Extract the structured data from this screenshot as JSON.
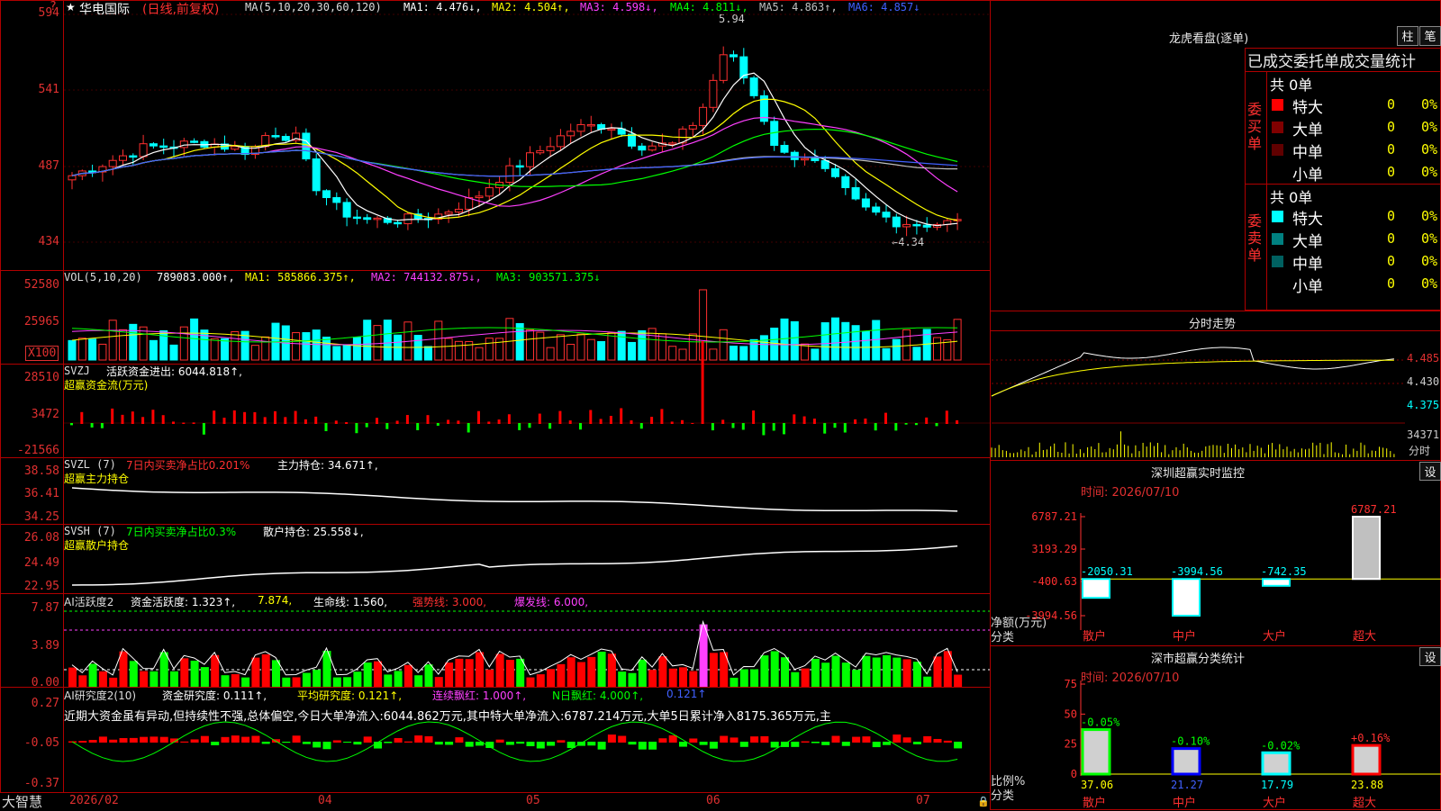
{
  "header": {
    "title": "华电国际",
    "mode": "(日线,前复权)",
    "ma_label": "MA(5,10,20,30,60,120)",
    "ma1": "MA1: 4.476↓,",
    "ma2": "MA2: 4.504↑,",
    "ma3": "MA3: 4.598↓,",
    "ma4": "MA4: 4.811↓,",
    "ma5": "MA5: 4.863↑,",
    "ma6": "MA6: 4.857↓",
    "high_mark": "5.94",
    "low_mark": "←4.34"
  },
  "price_axis": [
    "594",
    "541",
    "487",
    "434"
  ],
  "vol_panel": {
    "label": "VOL(5,10,20)",
    "value": "789083.000↑,",
    "ma1": "MA1: 585866.375↑,",
    "ma2": "MA2: 744132.875↓,",
    "ma3": "MA3: 903571.375↓",
    "axis": [
      "52580",
      "25965"
    ],
    "unit": "X100"
  },
  "svzj_panel": {
    "label": "SVZJ",
    "value": "活跃资金进出: 6044.818↑,",
    "sub": "超赢资金流(万元)",
    "axis": [
      "28510",
      "3472",
      "-21566"
    ]
  },
  "svzl_panel": {
    "label": "SVZL (7)",
    "value1": "7日内买卖净占比0.201%",
    "value2": "主力持仓: 34.671↑,",
    "sub": "超赢主力持仓",
    "axis": [
      "38.58",
      "36.41",
      "34.25"
    ]
  },
  "svsh_panel": {
    "label": "SVSH (7)",
    "value1": "7日内买卖净占比0.3%",
    "value2": "散户持仓: 25.558↓,",
    "sub": "超赢散户持仓",
    "axis": [
      "26.08",
      "24.49",
      "22.95"
    ]
  },
  "ai1_panel": {
    "label": "AI活跃度2",
    "v1": "资金活跃度: 1.323↑,",
    "v2": "7.874,",
    "v3": "生命线: 1.560,",
    "v4": "强势线: 3.000,",
    "v5": "爆发线: 6.000,",
    "axis": [
      "7.87",
      "3.89",
      "0.00"
    ]
  },
  "ai2_panel": {
    "label": "AI研究度2(10)",
    "v1": "资金研究度: 0.111↑,",
    "v2": "平均研究度: 0.121↑,",
    "v3": "连续飘红: 1.000↑,",
    "v4": "N日飘红: 4.000↑,",
    "v5": "0.121↑",
    "note": "近期大资金虽有异动,但持续性不强,总体偏空,今日大单净流入:6044.862万元,其中特大单净流入:6787.214万元,大单5日累计净入8175.365万元,主",
    "axis": [
      "0.27",
      "-0.05",
      "-0.37"
    ]
  },
  "date_axis": [
    "2026/02",
    "04",
    "05",
    "06",
    "07"
  ],
  "brand": "大智慧",
  "longhu": {
    "title": "龙虎看盘(逐单)",
    "btn1": "柱",
    "btn2": "笔",
    "subtitle": "已成交委托单成交量统计",
    "buy_label": "委买单",
    "sell_label": "委卖单",
    "buy_total": "共 0单",
    "sell_total": "共 0单",
    "buy_rows": [
      {
        "name": "特大",
        "count": "0",
        "pct": "0%",
        "color": "#ff0000"
      },
      {
        "name": "大单",
        "count": "0",
        "pct": "0%",
        "color": "#800000"
      },
      {
        "name": "中单",
        "count": "0",
        "pct": "0%",
        "color": "#600000"
      },
      {
        "name": "小单",
        "count": "0",
        "pct": "0%",
        "color": "#000000"
      }
    ],
    "sell_rows": [
      {
        "name": "特大",
        "count": "0",
        "pct": "0%",
        "color": "#00ffff"
      },
      {
        "name": "大单",
        "count": "0",
        "pct": "0%",
        "color": "#008080"
      },
      {
        "name": "中单",
        "count": "0",
        "pct": "0%",
        "color": "#006060"
      },
      {
        "name": "小单",
        "count": "0",
        "pct": "0%",
        "color": "#000000"
      }
    ]
  },
  "intraday": {
    "title": "分时走势",
    "p1": "4.485",
    "p2": "4.430",
    "p3": "4.375",
    "vol": "34371",
    "vol_label": "分时"
  },
  "monitor": {
    "title": "深圳超赢实时监控",
    "btn": "设",
    "time": "时间: 2026/07/10",
    "axis": [
      "6787.21",
      "3193.29",
      "-400.63",
      "-3994.56"
    ],
    "ylabel1": "净额(万元)",
    "ylabel2": "分类",
    "categories": [
      "散户",
      "中户",
      "大户",
      "超大"
    ],
    "values": [
      "-2050.31",
      "-3994.56",
      "-742.35",
      "6787.21"
    ]
  },
  "classify": {
    "title": "深市超赢分类统计",
    "btn": "设",
    "time": "时间: 2026/07/10",
    "axis": [
      "75",
      "50",
      "25",
      "0"
    ],
    "ylabel1": "比例%",
    "ylabel2": "分类",
    "categories": [
      "散户",
      "中户",
      "大户",
      "超大"
    ],
    "values": [
      "37.06",
      "21.27",
      "17.79",
      "23.88"
    ],
    "changes": [
      "-0.05%",
      "-0.10%",
      "-0.02%",
      "+0.16%"
    ]
  }
}
